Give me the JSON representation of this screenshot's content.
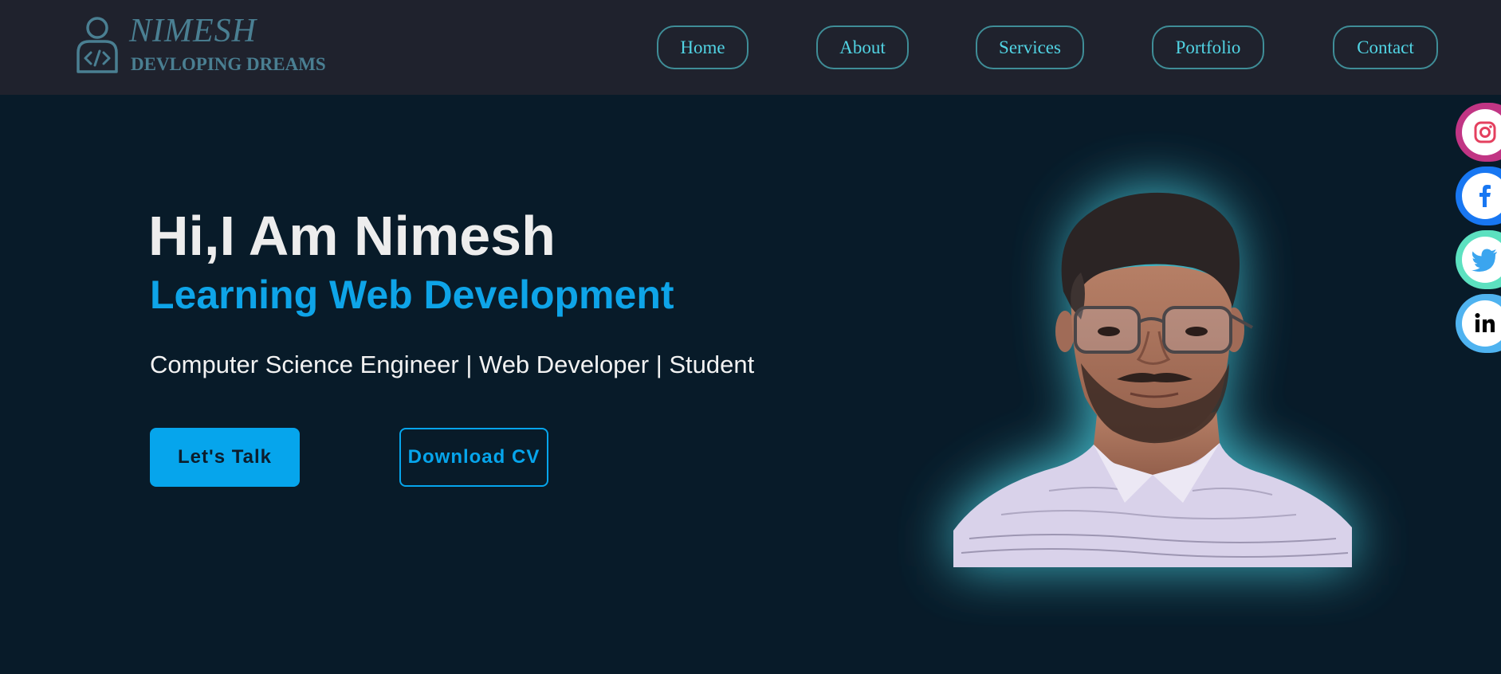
{
  "brand": {
    "name": "NIMESH",
    "tagline": "DEVLOPING DREAMS",
    "icon": "developer-person-icon"
  },
  "nav": {
    "items": [
      {
        "label": "Home"
      },
      {
        "label": "About"
      },
      {
        "label": "Services"
      },
      {
        "label": "Portfolio"
      },
      {
        "label": "Contact"
      }
    ]
  },
  "hero": {
    "greeting": "Hi,I Am Nimesh",
    "subtitle": "Learning Web Development",
    "roles": "Computer Science Engineer | Web Developer | Student",
    "primary_button": "Let's Talk",
    "secondary_button": "Download CV"
  },
  "social": [
    {
      "icon": "instagram-icon",
      "color": "#c13584"
    },
    {
      "icon": "facebook-icon",
      "color": "#1877f2"
    },
    {
      "icon": "twitter-icon",
      "color": "#5ce1c0"
    },
    {
      "icon": "linkedin-icon",
      "color": "#4fb3f0"
    }
  ],
  "colors": {
    "background": "#081b29",
    "header": "#1f222d",
    "accent": "#06a5ec",
    "nav_text": "#51d4e4",
    "logo": "#4a7f92"
  }
}
